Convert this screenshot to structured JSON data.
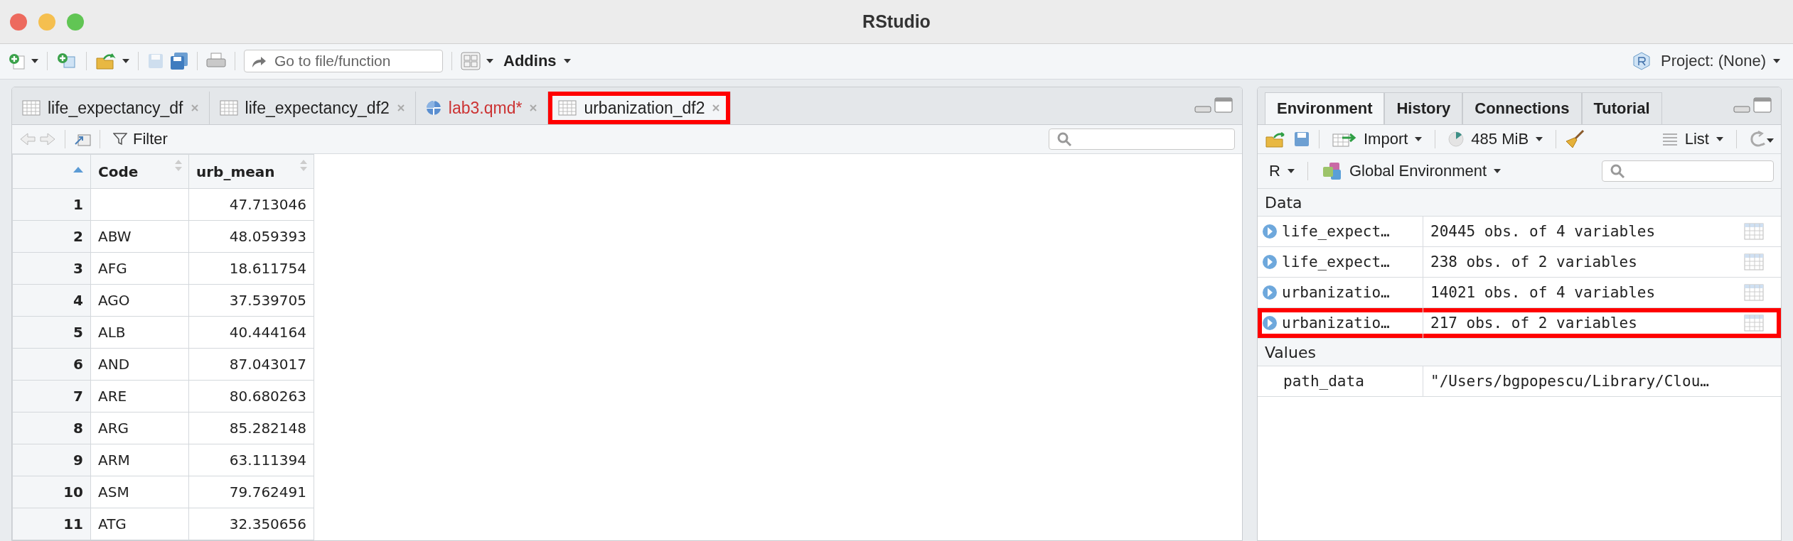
{
  "window": {
    "title": "RStudio"
  },
  "toolbar": {
    "goto_placeholder": "Go to file/function",
    "addins": "Addins",
    "project": "Project: (None)"
  },
  "editor": {
    "tabs": [
      {
        "label": "life_expectancy_df",
        "kind": "data",
        "modified": false,
        "selected": false,
        "highlighted": false
      },
      {
        "label": "life_expectancy_df2",
        "kind": "data",
        "modified": false,
        "selected": false,
        "highlighted": false
      },
      {
        "label": "lab3.qmd*",
        "kind": "doc",
        "modified": true,
        "selected": false,
        "highlighted": false
      },
      {
        "label": "urbanization_df2",
        "kind": "data",
        "modified": false,
        "selected": true,
        "highlighted": true
      }
    ],
    "filter": "Filter",
    "columns": [
      "Code",
      "urb_mean"
    ],
    "rows": [
      {
        "index": "1",
        "value": "47.713046"
      },
      {
        "index": "2",
        "code": "ABW",
        "value": "48.059393"
      },
      {
        "index": "3",
        "code": "AFG",
        "value": "18.611754"
      },
      {
        "index": "4",
        "code": "AGO",
        "value": "37.539705"
      },
      {
        "index": "5",
        "code": "ALB",
        "value": "40.444164"
      },
      {
        "index": "6",
        "code": "AND",
        "value": "87.043017"
      },
      {
        "index": "7",
        "code": "ARE",
        "value": "80.680263"
      },
      {
        "index": "8",
        "code": "ARG",
        "value": "85.282148"
      },
      {
        "index": "9",
        "code": "ARM",
        "value": "63.111394"
      },
      {
        "index": "10",
        "code": "ASM",
        "value": "79.762491"
      },
      {
        "index": "11",
        "code": "ATG",
        "value": "32.350656"
      }
    ]
  },
  "environment": {
    "tabs": [
      {
        "label": "Environment",
        "selected": true
      },
      {
        "label": "History",
        "selected": false
      },
      {
        "label": "Connections",
        "selected": false
      },
      {
        "label": "Tutorial",
        "selected": false
      }
    ],
    "import": "Import",
    "memory": "485 MiB",
    "view": "List",
    "language": "R",
    "scope": "Global Environment",
    "sections": [
      {
        "title": "Data",
        "items": [
          {
            "kind": "data",
            "name": "life_expect…",
            "value": "20445 obs. of 4 variables",
            "highlighted": false
          },
          {
            "kind": "data",
            "name": "life_expect…",
            "value": "238 obs. of 2 variables",
            "highlighted": false
          },
          {
            "kind": "data",
            "name": "urbanizatio…",
            "value": "14021 obs. of 4 variables",
            "highlighted": false
          },
          {
            "kind": "data",
            "name": "urbanizatio…",
            "value": "217 obs. of 2 variables",
            "highlighted": true
          }
        ]
      },
      {
        "title": "Values",
        "items": [
          {
            "kind": "value",
            "name": "path_data",
            "value": "\"/Users/bgpopescu/Library/Clou…",
            "highlighted": false
          }
        ]
      }
    ]
  }
}
